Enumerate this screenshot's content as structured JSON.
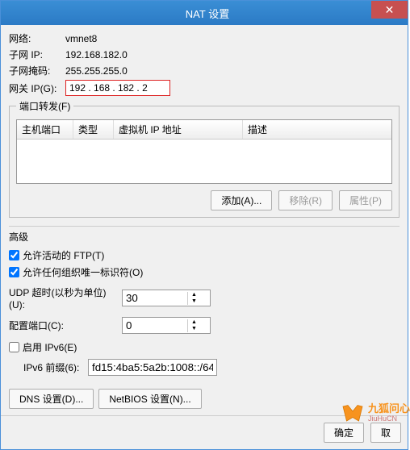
{
  "window": {
    "title": "NAT 设置",
    "close": "✕"
  },
  "info": {
    "network_label": "网络:",
    "network_value": "vmnet8",
    "subnet_label": "子网 IP:",
    "subnet_value": "192.168.182.0",
    "mask_label": "子网掩码:",
    "mask_value": "255.255.255.0",
    "gateway_label": "网关 IP(G):",
    "gateway_value": "192 . 168 . 182  .   2"
  },
  "portfwd": {
    "legend": "端口转发(F)",
    "columns": {
      "host_port": "主机端口",
      "type": "类型",
      "vm_ip": "虚拟机 IP 地址",
      "desc": "描述"
    },
    "buttons": {
      "add": "添加(A)...",
      "remove": "移除(R)",
      "props": "属性(P)"
    }
  },
  "advanced": {
    "header": "高级",
    "ftp_label": "允许活动的 FTP(T)",
    "ftp_checked": true,
    "org_label": "允许任何组织唯一标识符(O)",
    "org_checked": true,
    "udp_label": "UDP 超时(以秒为单位)(U):",
    "udp_value": "30",
    "cfgport_label": "配置端口(C):",
    "cfgport_value": "0",
    "ipv6_label": "启用 IPv6(E)",
    "ipv6_checked": false,
    "ipv6prefix_label": "IPv6 前缀(6):",
    "ipv6prefix_value": "fd15:4ba5:5a2b:1008::/64",
    "dns_btn": "DNS 设置(D)...",
    "netbios_btn": "NetBIOS 设置(N)..."
  },
  "footer": {
    "ok": "确定",
    "cancel": "取"
  },
  "watermark": {
    "cn": "九狐问心",
    "en": "JiuHuCN"
  }
}
